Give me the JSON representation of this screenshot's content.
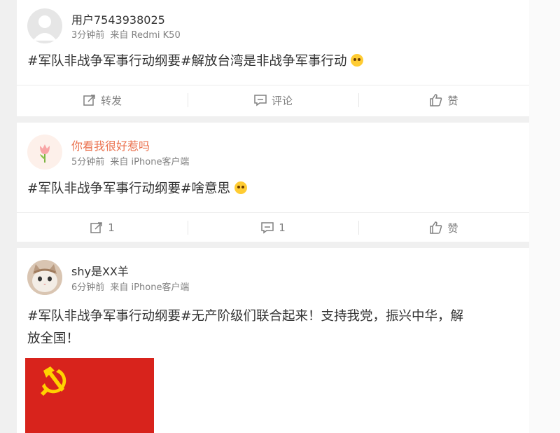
{
  "posts": [
    {
      "username": "用户7543938025",
      "time": "3分钟前",
      "source": "来自 Redmi K50",
      "text": "#军队非战争军事行动纲要#解放台湾是非战争军事行动",
      "emoji": "smirk-emoji",
      "actions": {
        "repost": "转发",
        "comment": "评论",
        "like": "赞"
      }
    },
    {
      "username": "你看我很好惹吗",
      "time": "5分钟前",
      "source": "来自 iPhone客户端",
      "text": "#军队非战争军事行动纲要#啥意思",
      "emoji": "shocked-emoji",
      "actions": {
        "repost": "1",
        "comment": "1",
        "like": "赞"
      }
    },
    {
      "username": "shy是XX羊",
      "time": "6分钟前",
      "source": "来自 iPhone客户端",
      "text_line1": "#军队非战争军事行动纲要#无产阶级们联合起来！支持我党，振兴中华，解",
      "text_line2": "放全国！",
      "image": "hammer-and-sickle-flag"
    }
  ],
  "colors": {
    "username_highlight": "#eb7350",
    "flag_red": "#d8231c",
    "flag_gold": "#ffd200"
  }
}
